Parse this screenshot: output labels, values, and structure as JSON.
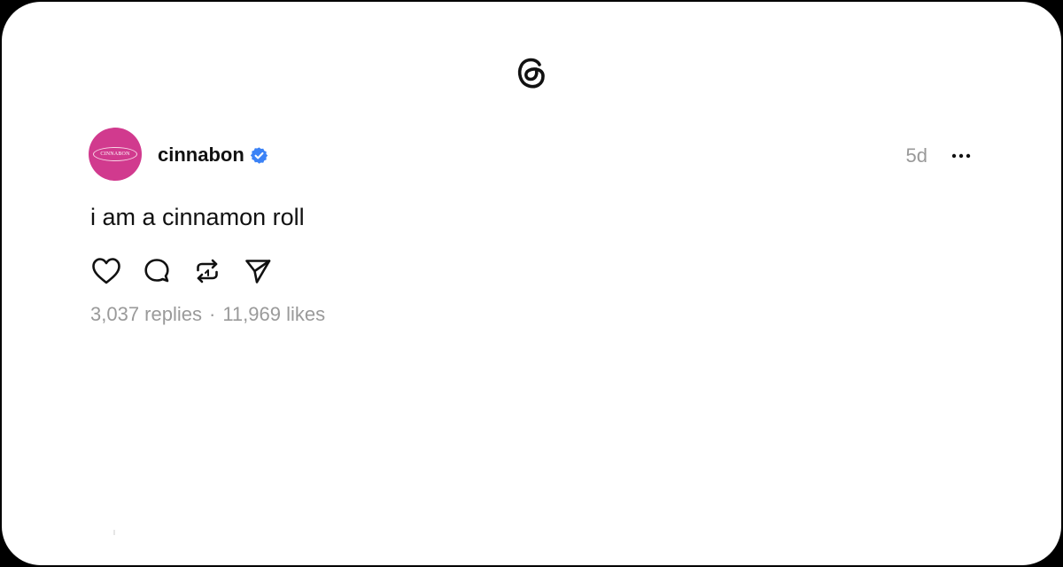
{
  "app": {
    "logo_icon": "threads-logo-icon"
  },
  "post": {
    "author": {
      "username": "cinnabon",
      "avatar_text": "CINNABON",
      "avatar_color": "#d13a8e",
      "verified": true,
      "verified_color": "#3b82f6"
    },
    "timestamp": "5d",
    "text": "i am a cinnamon roll",
    "actions": [
      {
        "name": "like",
        "icon": "heart-icon"
      },
      {
        "name": "reply",
        "icon": "comment-icon"
      },
      {
        "name": "repost",
        "icon": "repost-icon"
      },
      {
        "name": "share",
        "icon": "send-icon"
      }
    ],
    "stats": {
      "replies": "3,037 replies",
      "separator": "·",
      "likes": "11,969 likes"
    }
  }
}
